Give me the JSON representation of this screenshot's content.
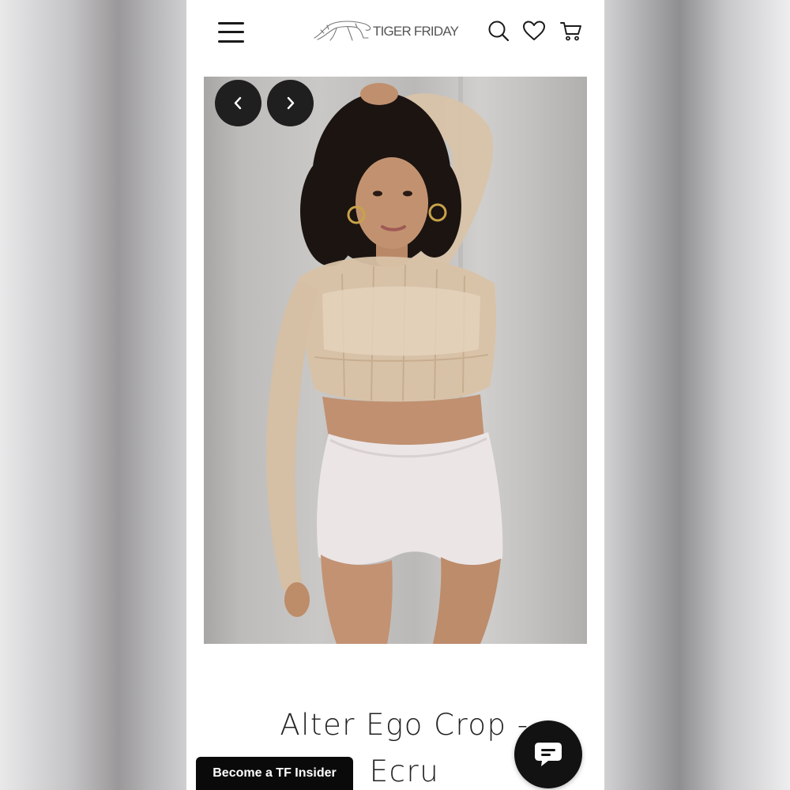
{
  "header": {
    "brand_name": "TIGER FRIDAY",
    "menu_icon": "hamburger-menu-icon",
    "search_icon": "search-icon",
    "wishlist_icon": "heart-icon",
    "cart_icon": "shopping-cart-icon"
  },
  "gallery": {
    "prev_icon": "chevron-left-icon",
    "next_icon": "chevron-right-icon"
  },
  "product": {
    "title_line1": "Alter Ego Crop -",
    "title_line2": "Ecru"
  },
  "promo": {
    "insider_label": "Become a TF Insider"
  },
  "chat": {
    "icon": "chat-bubble-icon"
  },
  "colors": {
    "button_dark": "#1f1f1f",
    "text_primary": "#222222",
    "promo_bg": "#0a0a0a"
  }
}
